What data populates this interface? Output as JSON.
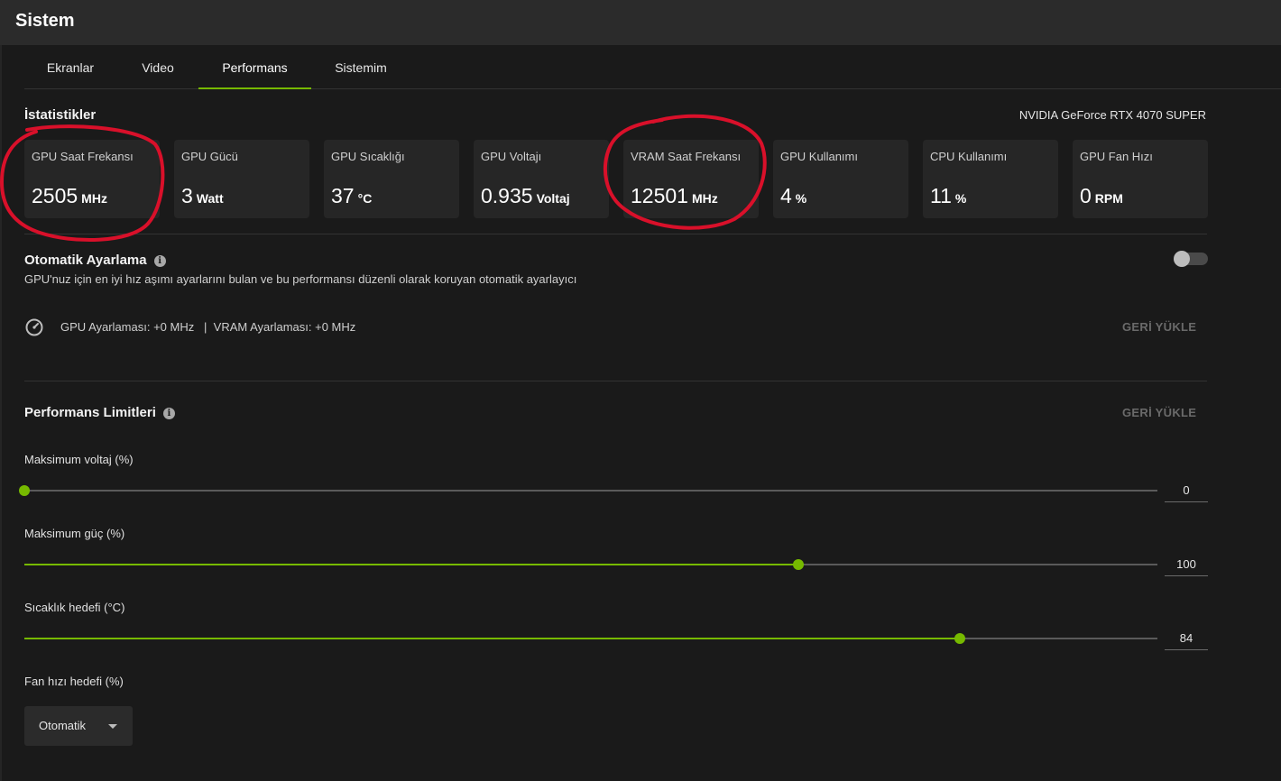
{
  "window": {
    "title": "Sistem"
  },
  "tabs": [
    {
      "label": "Ekranlar"
    },
    {
      "label": "Video"
    },
    {
      "label": "Performans",
      "active": true
    },
    {
      "label": "Sistemim"
    }
  ],
  "stats": {
    "title": "İstatistikler",
    "gpu_name": "NVIDIA GeForce RTX 4070 SUPER",
    "cards": [
      {
        "label": "GPU Saat Frekansı",
        "value": "2505",
        "unit": "MHz"
      },
      {
        "label": "GPU Gücü",
        "value": "3",
        "unit": "Watt"
      },
      {
        "label": "GPU Sıcaklığı",
        "value": "37",
        "unit": "°C"
      },
      {
        "label": "GPU Voltajı",
        "value": "0.935",
        "unit": "Voltaj"
      },
      {
        "label": "VRAM Saat Frekansı",
        "value": "12501",
        "unit": "MHz"
      },
      {
        "label": "GPU Kullanımı",
        "value": "4",
        "unit": "%"
      },
      {
        "label": "CPU Kullanımı",
        "value": "11",
        "unit": "%"
      },
      {
        "label": "GPU Fan Hızı",
        "value": "0",
        "unit": "RPM"
      }
    ]
  },
  "auto_tune": {
    "title": "Otomatik Ayarlama",
    "description": "GPU'nuz için en iyi hız aşımı ayarlarını bulan ve bu performansı düzenli olarak koruyan otomatik ayarlayıcı",
    "enabled": false,
    "adjustments": "GPU Ayarlaması: +0 MHz   |  VRAM Ayarlaması: +0 MHz",
    "reset_label": "GERİ YÜKLE"
  },
  "limits": {
    "title": "Performans Limitleri",
    "reset_label": "GERİ YÜKLE",
    "sliders": [
      {
        "label": "Maksimum voltaj (%)",
        "value": "0",
        "fraction": 0.0
      },
      {
        "label": "Maksimum güç (%)",
        "value": "100",
        "fraction": 0.683
      },
      {
        "label": "Sıcaklık hedefi (°C)",
        "value": "84",
        "fraction": 0.826
      }
    ],
    "fan": {
      "label": "Fan hızı hedefi (%)",
      "selected": "Otomatik"
    }
  },
  "colors": {
    "accent": "#76b900",
    "annotation": "#d9102a"
  }
}
